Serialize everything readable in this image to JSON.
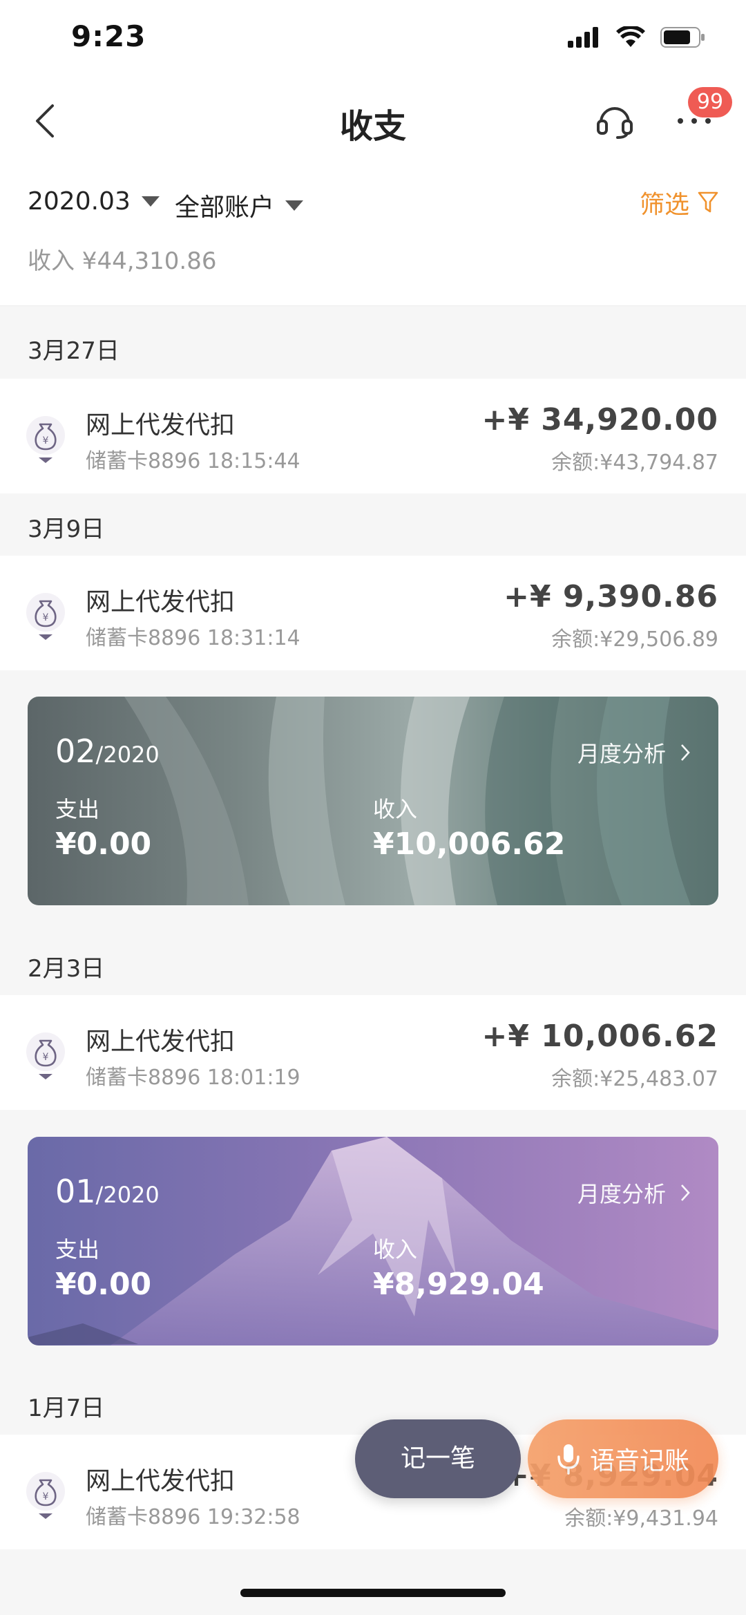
{
  "status_bar": {
    "time": "9:23"
  },
  "nav": {
    "title": "收支",
    "badge": "99"
  },
  "filter": {
    "month": "2020.03",
    "account": "全部账户",
    "filter_label": "筛选",
    "income_summary": "收入 ¥44,310.86"
  },
  "groups": [
    {
      "date": "3月27日",
      "title": "网上代发代扣",
      "sub": "储蓄卡8896 18:15:44",
      "amount": "+¥ 34,920.00",
      "balance": "余额:¥43,794.87"
    },
    {
      "date": "3月9日",
      "title": "网上代发代扣",
      "sub": "储蓄卡8896 18:31:14",
      "amount": "+¥ 9,390.86",
      "balance": "余额:¥29,506.89"
    },
    {
      "date": "2月3日",
      "title": "网上代发代扣",
      "sub": "储蓄卡8896 18:01:19",
      "amount": "+¥ 10,006.62",
      "balance": "余额:¥25,483.07"
    },
    {
      "date": "1月7日",
      "title": "网上代发代扣",
      "sub": "储蓄卡8896 19:32:58",
      "amount": "+¥ 8,929.04",
      "balance": "余额:¥9,431.94"
    }
  ],
  "cards": [
    {
      "month": "02",
      "year": "/2020",
      "link": "月度分析",
      "expense_label": "支出",
      "expense": "¥0.00",
      "income_label": "收入",
      "income": "¥10,006.62",
      "theme": "agave"
    },
    {
      "month": "01",
      "year": "/2020",
      "link": "月度分析",
      "expense_label": "支出",
      "expense": "¥0.00",
      "income_label": "收入",
      "income": "¥8,929.04",
      "theme": "mountain"
    }
  ],
  "fab": {
    "record": "记一笔",
    "voice": "语音记账"
  },
  "colors": {
    "accent_orange": "#f0922d",
    "badge_red": "#ef5b54",
    "fab_dark": "#5d5e76",
    "fab_orange": "#f28a55"
  }
}
